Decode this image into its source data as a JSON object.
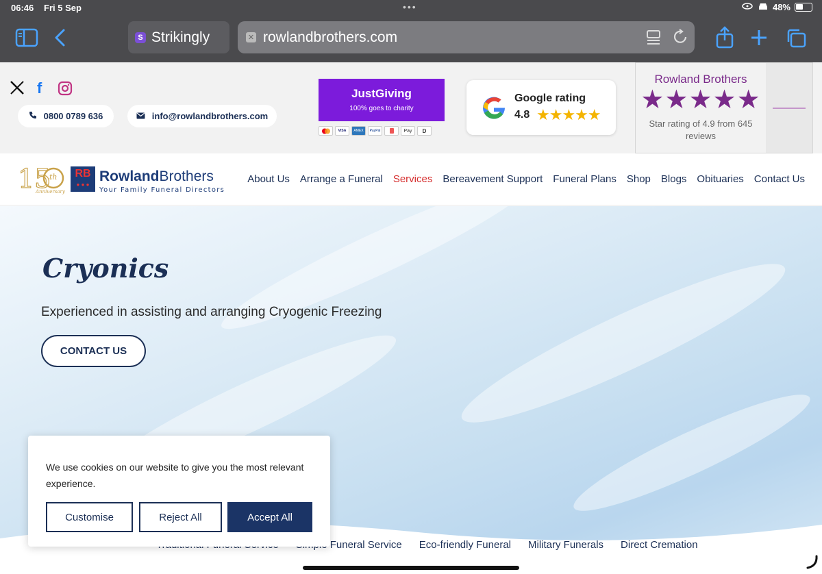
{
  "status_bar": {
    "time": "06:46",
    "date": "Fri 5 Sep",
    "battery": "48%",
    "battery_level": 0.48
  },
  "browser": {
    "tab_title": "Strikingly",
    "url": "rowlandbrothers.com",
    "icons": [
      "sidebar-icon",
      "back-icon",
      "reader-icon",
      "reload-icon",
      "share-icon",
      "new-tab-icon",
      "tabs-icon"
    ]
  },
  "topbar": {
    "phone": "0800 0789 636",
    "email": "info@rowlandbrothers.com",
    "justgiving": {
      "title": "JustGiving",
      "subtitle": "100% goes to charity"
    },
    "payment_methods": [
      "Mastercard",
      "VISA",
      "AMEX",
      "PayPal",
      "Card",
      "Pay",
      "D"
    ],
    "google": {
      "label": "Google rating",
      "score": "4.8",
      "stars": "★★★★★"
    },
    "reviews": {
      "name": "Rowland Brothers",
      "stars": "★★★★★",
      "text": "Star rating of 4.9 from 645 reviews"
    }
  },
  "brand": {
    "rb": "RB",
    "name_a": "Rowland",
    "name_b": "Brothers",
    "tagline": "Your Family Funeral Directors",
    "anniversary": "150th Anniversary"
  },
  "nav": {
    "items": [
      {
        "label": "About Us"
      },
      {
        "label": "Arrange a Funeral"
      },
      {
        "label": "Services"
      },
      {
        "label": "Bereavement Support"
      },
      {
        "label": "Funeral Plans"
      },
      {
        "label": "Shop"
      },
      {
        "label": "Blogs"
      },
      {
        "label": "Obituaries"
      },
      {
        "label": "Contact Us"
      }
    ],
    "active": "Services"
  },
  "hero": {
    "title": "Cryonics",
    "subtitle": "Experienced in assisting and arranging Cryogenic Freezing",
    "cta": "CONTACT US"
  },
  "sub_links": [
    "Traditional Funeral Service",
    "Simple Funeral Service",
    "Eco-friendly Funeral",
    "Military Funerals",
    "Direct Cremation"
  ],
  "cookie": {
    "text": "We use cookies on our website to give you the most relevant experience.",
    "customise": "Customise",
    "reject": "Reject All",
    "accept": "Accept All"
  },
  "colors": {
    "navy": "#1b2f55",
    "active_red": "#d52d2d",
    "justgiving_purple": "#7c1bdb",
    "review_purple": "#7a2a8a",
    "google_star": "#f4b400",
    "safari_blue": "#4aa3ff"
  }
}
